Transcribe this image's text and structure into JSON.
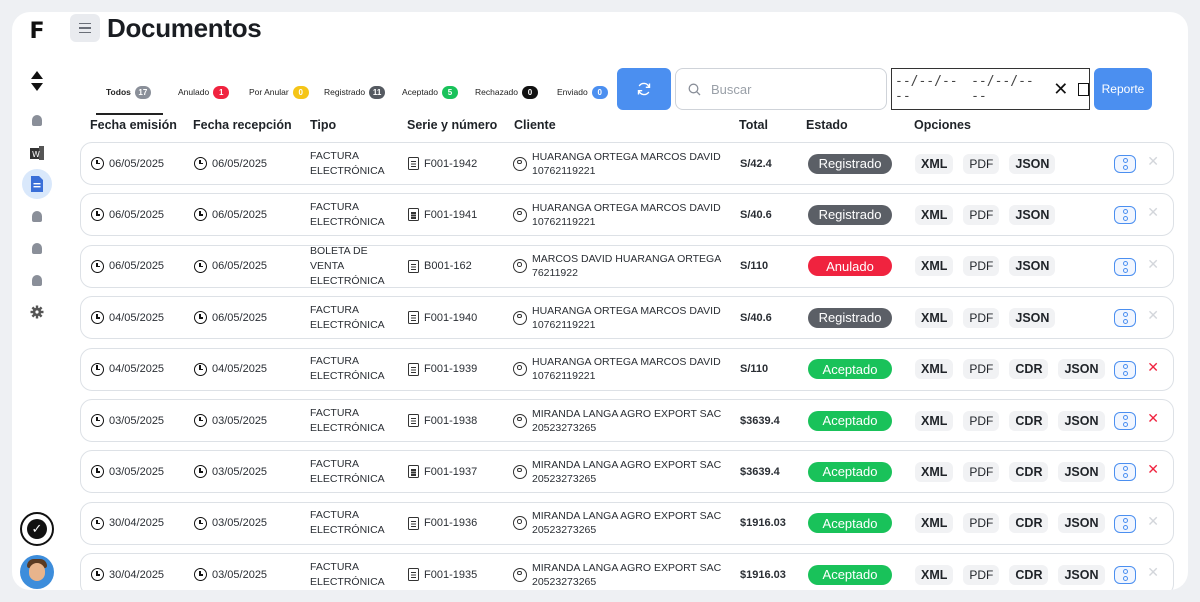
{
  "page": {
    "title": "Documentos"
  },
  "tabs": [
    {
      "label": "Todos",
      "count": "17",
      "color": "#8a8f99"
    },
    {
      "label": "Anulado",
      "count": "1",
      "color": "#f0233f"
    },
    {
      "label": "Por Anular",
      "count": "0",
      "color": "#f5c518"
    },
    {
      "label": "Registrado",
      "count": "11",
      "color": "#555a61"
    },
    {
      "label": "Aceptado",
      "count": "5",
      "color": "#19c25a"
    },
    {
      "label": "Rechazado",
      "count": "0",
      "color": "#111111"
    },
    {
      "label": "Enviado",
      "count": "0",
      "color": "#4b8ff0"
    }
  ],
  "search": {
    "placeholder": "Buscar"
  },
  "date_range": {
    "from": "--/--/----",
    "to": "--/--/----"
  },
  "report_label": "Reporte",
  "columns": [
    "Fecha emisión",
    "Fecha recepción",
    "Tipo",
    "Serie y número",
    "Cliente",
    "Total",
    "Estado",
    "Opciones"
  ],
  "status_colors": {
    "Registrado": "#5b5f66",
    "Anulado": "#f0233f",
    "Aceptado": "#19c25a"
  },
  "rows": [
    {
      "fecha_emision": "06/05/2025",
      "fecha_recepcion": "06/05/2025",
      "tipo": "FACTURA ELECTRÓNICA",
      "serie": "F001-1942",
      "cliente": "HUARANGA ORTEGA MARCOS DAVID",
      "doc": "10762119221",
      "total": "S/42.4",
      "estado": "Registrado",
      "opciones": [
        "XML",
        "PDF",
        "JSON"
      ],
      "delete_active": false
    },
    {
      "fecha_emision": "06/05/2025",
      "fecha_recepcion": "06/05/2025",
      "tipo": "FACTURA ELECTRÓNICA",
      "serie": "F001-1941",
      "cliente": "HUARANGA ORTEGA MARCOS DAVID",
      "doc": "10762119221",
      "total": "S/40.6",
      "estado": "Registrado",
      "opciones": [
        "XML",
        "PDF",
        "JSON"
      ],
      "delete_active": false
    },
    {
      "fecha_emision": "06/05/2025",
      "fecha_recepcion": "06/05/2025",
      "tipo": "BOLETA DE VENTA ELECTRÓNICA",
      "serie": "B001-162",
      "cliente": "MARCOS DAVID HUARANGA ORTEGA",
      "doc": "76211922",
      "total": "S/110",
      "estado": "Anulado",
      "opciones": [
        "XML",
        "PDF",
        "JSON"
      ],
      "delete_active": false
    },
    {
      "fecha_emision": "04/05/2025",
      "fecha_recepcion": "06/05/2025",
      "tipo": "FACTURA ELECTRÓNICA",
      "serie": "F001-1940",
      "cliente": "HUARANGA ORTEGA MARCOS DAVID",
      "doc": "10762119221",
      "total": "S/40.6",
      "estado": "Registrado",
      "opciones": [
        "XML",
        "PDF",
        "JSON"
      ],
      "delete_active": false
    },
    {
      "fecha_emision": "04/05/2025",
      "fecha_recepcion": "04/05/2025",
      "tipo": "FACTURA ELECTRÓNICA",
      "serie": "F001-1939",
      "cliente": "HUARANGA ORTEGA MARCOS DAVID",
      "doc": "10762119221",
      "total": "S/110",
      "estado": "Aceptado",
      "opciones": [
        "XML",
        "PDF",
        "CDR",
        "JSON"
      ],
      "delete_active": true
    },
    {
      "fecha_emision": "03/05/2025",
      "fecha_recepcion": "03/05/2025",
      "tipo": "FACTURA ELECTRÓNICA",
      "serie": "F001-1938",
      "cliente": "MIRANDA LANGA AGRO EXPORT SAC",
      "doc": "20523273265",
      "total": "$3639.4",
      "estado": "Aceptado",
      "opciones": [
        "XML",
        "PDF",
        "CDR",
        "JSON"
      ],
      "delete_active": true
    },
    {
      "fecha_emision": "03/05/2025",
      "fecha_recepcion": "03/05/2025",
      "tipo": "FACTURA ELECTRÓNICA",
      "serie": "F001-1937",
      "cliente": "MIRANDA LANGA AGRO EXPORT SAC",
      "doc": "20523273265",
      "total": "$3639.4",
      "estado": "Aceptado",
      "opciones": [
        "XML",
        "PDF",
        "CDR",
        "JSON"
      ],
      "delete_active": true
    },
    {
      "fecha_emision": "30/04/2025",
      "fecha_recepcion": "03/05/2025",
      "tipo": "FACTURA ELECTRÓNICA",
      "serie": "F001-1936",
      "cliente": "MIRANDA LANGA AGRO EXPORT SAC",
      "doc": "20523273265",
      "total": "$1916.03",
      "estado": "Aceptado",
      "opciones": [
        "XML",
        "PDF",
        "CDR",
        "JSON"
      ],
      "delete_active": false
    },
    {
      "fecha_emision": "30/04/2025",
      "fecha_recepcion": "03/05/2025",
      "tipo": "FACTURA ELECTRÓNICA",
      "serie": "F001-1935",
      "cliente": "MIRANDA LANGA AGRO EXPORT SAC",
      "doc": "20523273265",
      "total": "$1916.03",
      "estado": "Aceptado",
      "opciones": [
        "XML",
        "PDF",
        "CDR",
        "JSON"
      ],
      "delete_active": false
    }
  ]
}
